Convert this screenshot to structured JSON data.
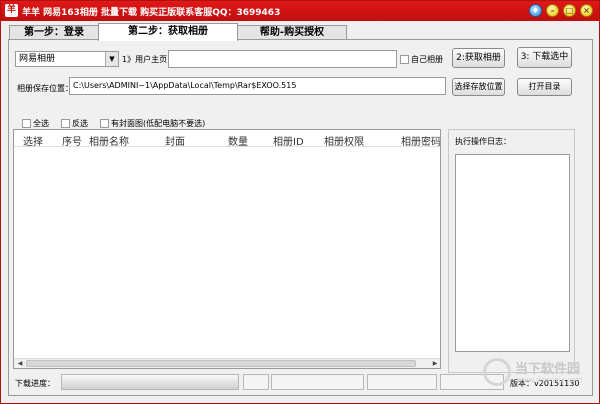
{
  "window": {
    "title": "羊羊 网易163相册 批量下载 购买正版联系客服QQ：3699463",
    "app_icon": "羊",
    "controls": {
      "skin": "♦",
      "minimize": "–",
      "maximize": "□",
      "close": "×"
    }
  },
  "tabs": [
    {
      "label": "第一步：登录",
      "active": false
    },
    {
      "label": "第二步：获取相册",
      "active": true
    },
    {
      "label": "帮助-购买授权",
      "active": false
    }
  ],
  "form": {
    "album_source": "网易相册",
    "user_home_label": "1》用户主页",
    "user_home_value": "",
    "my_album_label": "自己相册",
    "get_albums_button": "2:获取相册",
    "download_selected_button": "3: 下载选中",
    "save_path_label": "相册保存位置：",
    "save_path_value": "C:\\Users\\ADMINI~1\\AppData\\Local\\Temp\\Rar$EXOO.515",
    "choose_location_button": "选择存放位置",
    "open_folder_button": "打开目录"
  },
  "options": {
    "select_all": "全选",
    "invert": "反选",
    "has_cover": "有封面图(低配电脑不要选)"
  },
  "table": {
    "columns": [
      "选择",
      "序号",
      "相册名称",
      "封面",
      "数量",
      "相册ID",
      "相册权限",
      "相册密码"
    ],
    "rows": []
  },
  "log": {
    "title": "执行操作日志：",
    "content": ""
  },
  "status": {
    "progress_label": "下载进度：",
    "version": "版本：v20151130"
  },
  "watermark": {
    "text": "当下软件园",
    "sub": "www.downxia.com"
  }
}
